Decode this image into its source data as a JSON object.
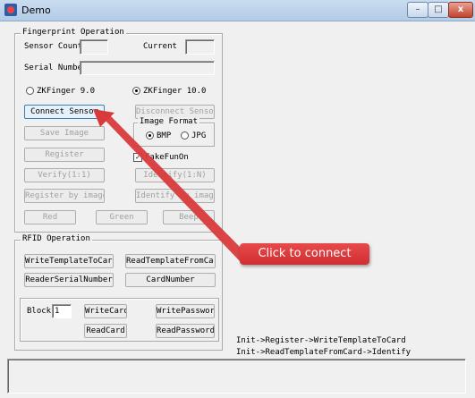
{
  "window": {
    "title": "Demo",
    "minimize": "–",
    "maximize": "□",
    "close": "x"
  },
  "fingerprint": {
    "group_label": "Fingerprint Operation",
    "sensor_count_label": "Sensor Count",
    "sensor_count_value": "",
    "current_label": "Current",
    "current_value": "",
    "serial_label": "Serial Number",
    "serial_value": "",
    "radio_zk9": "ZKFinger 9.0",
    "radio_zk10": "ZKFinger 10.0",
    "selected_version": "ZKFinger 10.0",
    "connect": "Connect Sensor",
    "disconnect": "Disconnect Sensor",
    "image_format_label": "Image Format",
    "bmp": "BMP",
    "jpg": "JPG",
    "selected_format": "BMP",
    "save_image": "Save Image",
    "register": "Register",
    "fake_fun_on": "FakeFunOn",
    "fake_fun_checked": true,
    "verify": "Verify(1:1)",
    "identify": "Identify(1:N)",
    "register_by_image": "Register by image",
    "identify_by_image": "Identify by image",
    "red": "Red",
    "green": "Green",
    "beep": "Beep"
  },
  "rfid": {
    "group_label": "RFID Operation",
    "write_template": "WriteTemplateToCard",
    "read_template": "ReadTemplateFromCard",
    "reader_serial": "ReaderSerialNumber",
    "card_number": "CardNumber",
    "block_label": "Block",
    "block_value": "1",
    "write_card": "WriteCard",
    "write_password": "WritePassword",
    "read_card": "ReadCard",
    "read_password": "ReadPassword"
  },
  "hints": {
    "line1": "Init->Register->WriteTemplateToCard",
    "line2": "Init->ReadTemplateFromCard->Identify"
  },
  "status": {
    "text": ""
  },
  "annotation": {
    "text": "Click to connect",
    "color": "#d83a3b"
  },
  "colors": {
    "titlebar": "#b9cfe8",
    "window_bg": "#f0f0f0",
    "callout": "#d83a3b"
  }
}
